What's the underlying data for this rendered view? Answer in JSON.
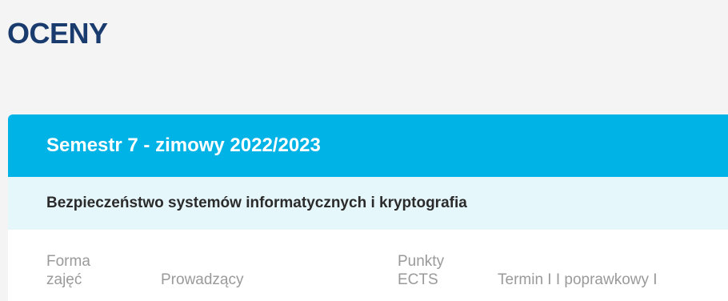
{
  "page": {
    "title": "OCENY"
  },
  "semester": {
    "title": "Semestr 7 - zimowy 2022/2023"
  },
  "course": {
    "name": "Bezpieczeństwo systemów informatycznych i kryptografia"
  },
  "table": {
    "columns": {
      "forma_line1": "Forma",
      "forma_line2": "zajęć",
      "prowadzacy": "Prowadzący",
      "punkty_line1": "Punkty",
      "punkty_line2": "ECTS",
      "termin": "Termin I I poprawkowy I"
    }
  },
  "colors": {
    "title": "#1a3b6e",
    "semester_header_bg": "#00b3e6",
    "course_row_bg": "#e6f7fc",
    "column_header_text": "#9a9a9a"
  }
}
